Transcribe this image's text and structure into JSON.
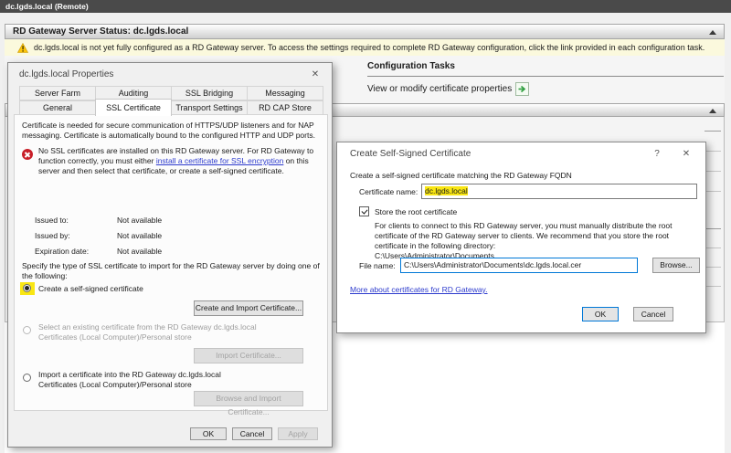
{
  "window": {
    "title": "dc.lgds.local (Remote)"
  },
  "icons": {
    "collapse": "▲",
    "close": "✕",
    "help": "?",
    "warning": "!"
  },
  "status": {
    "header": "RD Gateway Server Status: dc.lgds.local",
    "warning": "dc.lgds.local is not yet fully configured as a RD Gateway server. To access the settings required to complete RD Gateway configuration, click the link provided in each configuration task."
  },
  "config_tasks": {
    "title": "Configuration Tasks",
    "task": "View or modify certificate properties"
  },
  "properties_dialog": {
    "title": "dc.lgds.local Properties",
    "tabs_row1": [
      "Server Farm",
      "Auditing",
      "SSL Bridging",
      "Messaging"
    ],
    "tabs_row2": [
      "General",
      "SSL Certificate",
      "Transport Settings",
      "RD CAP Store"
    ],
    "intro": "Certificate is needed for secure communication of HTTPS/UDP listeners and for NAP messaging. Certificate is automatically bound to the configured HTTP and UDP ports.",
    "error_pre": "No SSL certificates are installed on this RD Gateway server. For RD Gateway to function correctly, you must either ",
    "error_link": "install a certificate for SSL encryption",
    "error_post": " on this server and then select that certificate, or create a self-signed certificate.",
    "fields": [
      {
        "label": "Issued to:",
        "value": "Not available"
      },
      {
        "label": "Issued by:",
        "value": "Not available"
      },
      {
        "label": "Expiration date:",
        "value": "Not available"
      }
    ],
    "specify": "Specify the type of SSL certificate to import for the RD Gateway server by doing one of the following:",
    "radio_self_signed": "Create a self-signed certificate",
    "btn_create_import": "Create and Import Certificate...",
    "radio_existing": "Select an existing certificate from the RD Gateway dc.lgds.local Certificates (Local Computer)/Personal store",
    "btn_import": "Import Certificate...",
    "radio_import": "Import a certificate into the RD Gateway dc.lgds.local Certificates (Local Computer)/Personal store",
    "btn_browse_import": "Browse and Import Certificate...",
    "ok": "OK",
    "cancel": "Cancel",
    "apply": "Apply"
  },
  "create_dialog": {
    "title": "Create Self-Signed Certificate",
    "subtitle": "Create a self-signed certificate matching the RD Gateway FQDN",
    "cert_name_label": "Certificate name:",
    "cert_name_value": "dc.lgds.local",
    "store_root_label": "Store the root certificate",
    "store_root_desc": "For clients to connect to this RD Gateway server, you must manually distribute the root certificate of the RD Gateway server to clients. We recommend that you store the root certificate in the following directory:",
    "store_root_dir": "C:\\Users\\Administrator\\Documents",
    "file_name_label": "File name:",
    "file_name_value": "C:\\Users\\Administrator\\Documents\\dc.lgds.local.cer",
    "browse": "Browse...",
    "link": "More about certificates for RD Gateway.",
    "ok": "OK",
    "cancel": "Cancel"
  }
}
